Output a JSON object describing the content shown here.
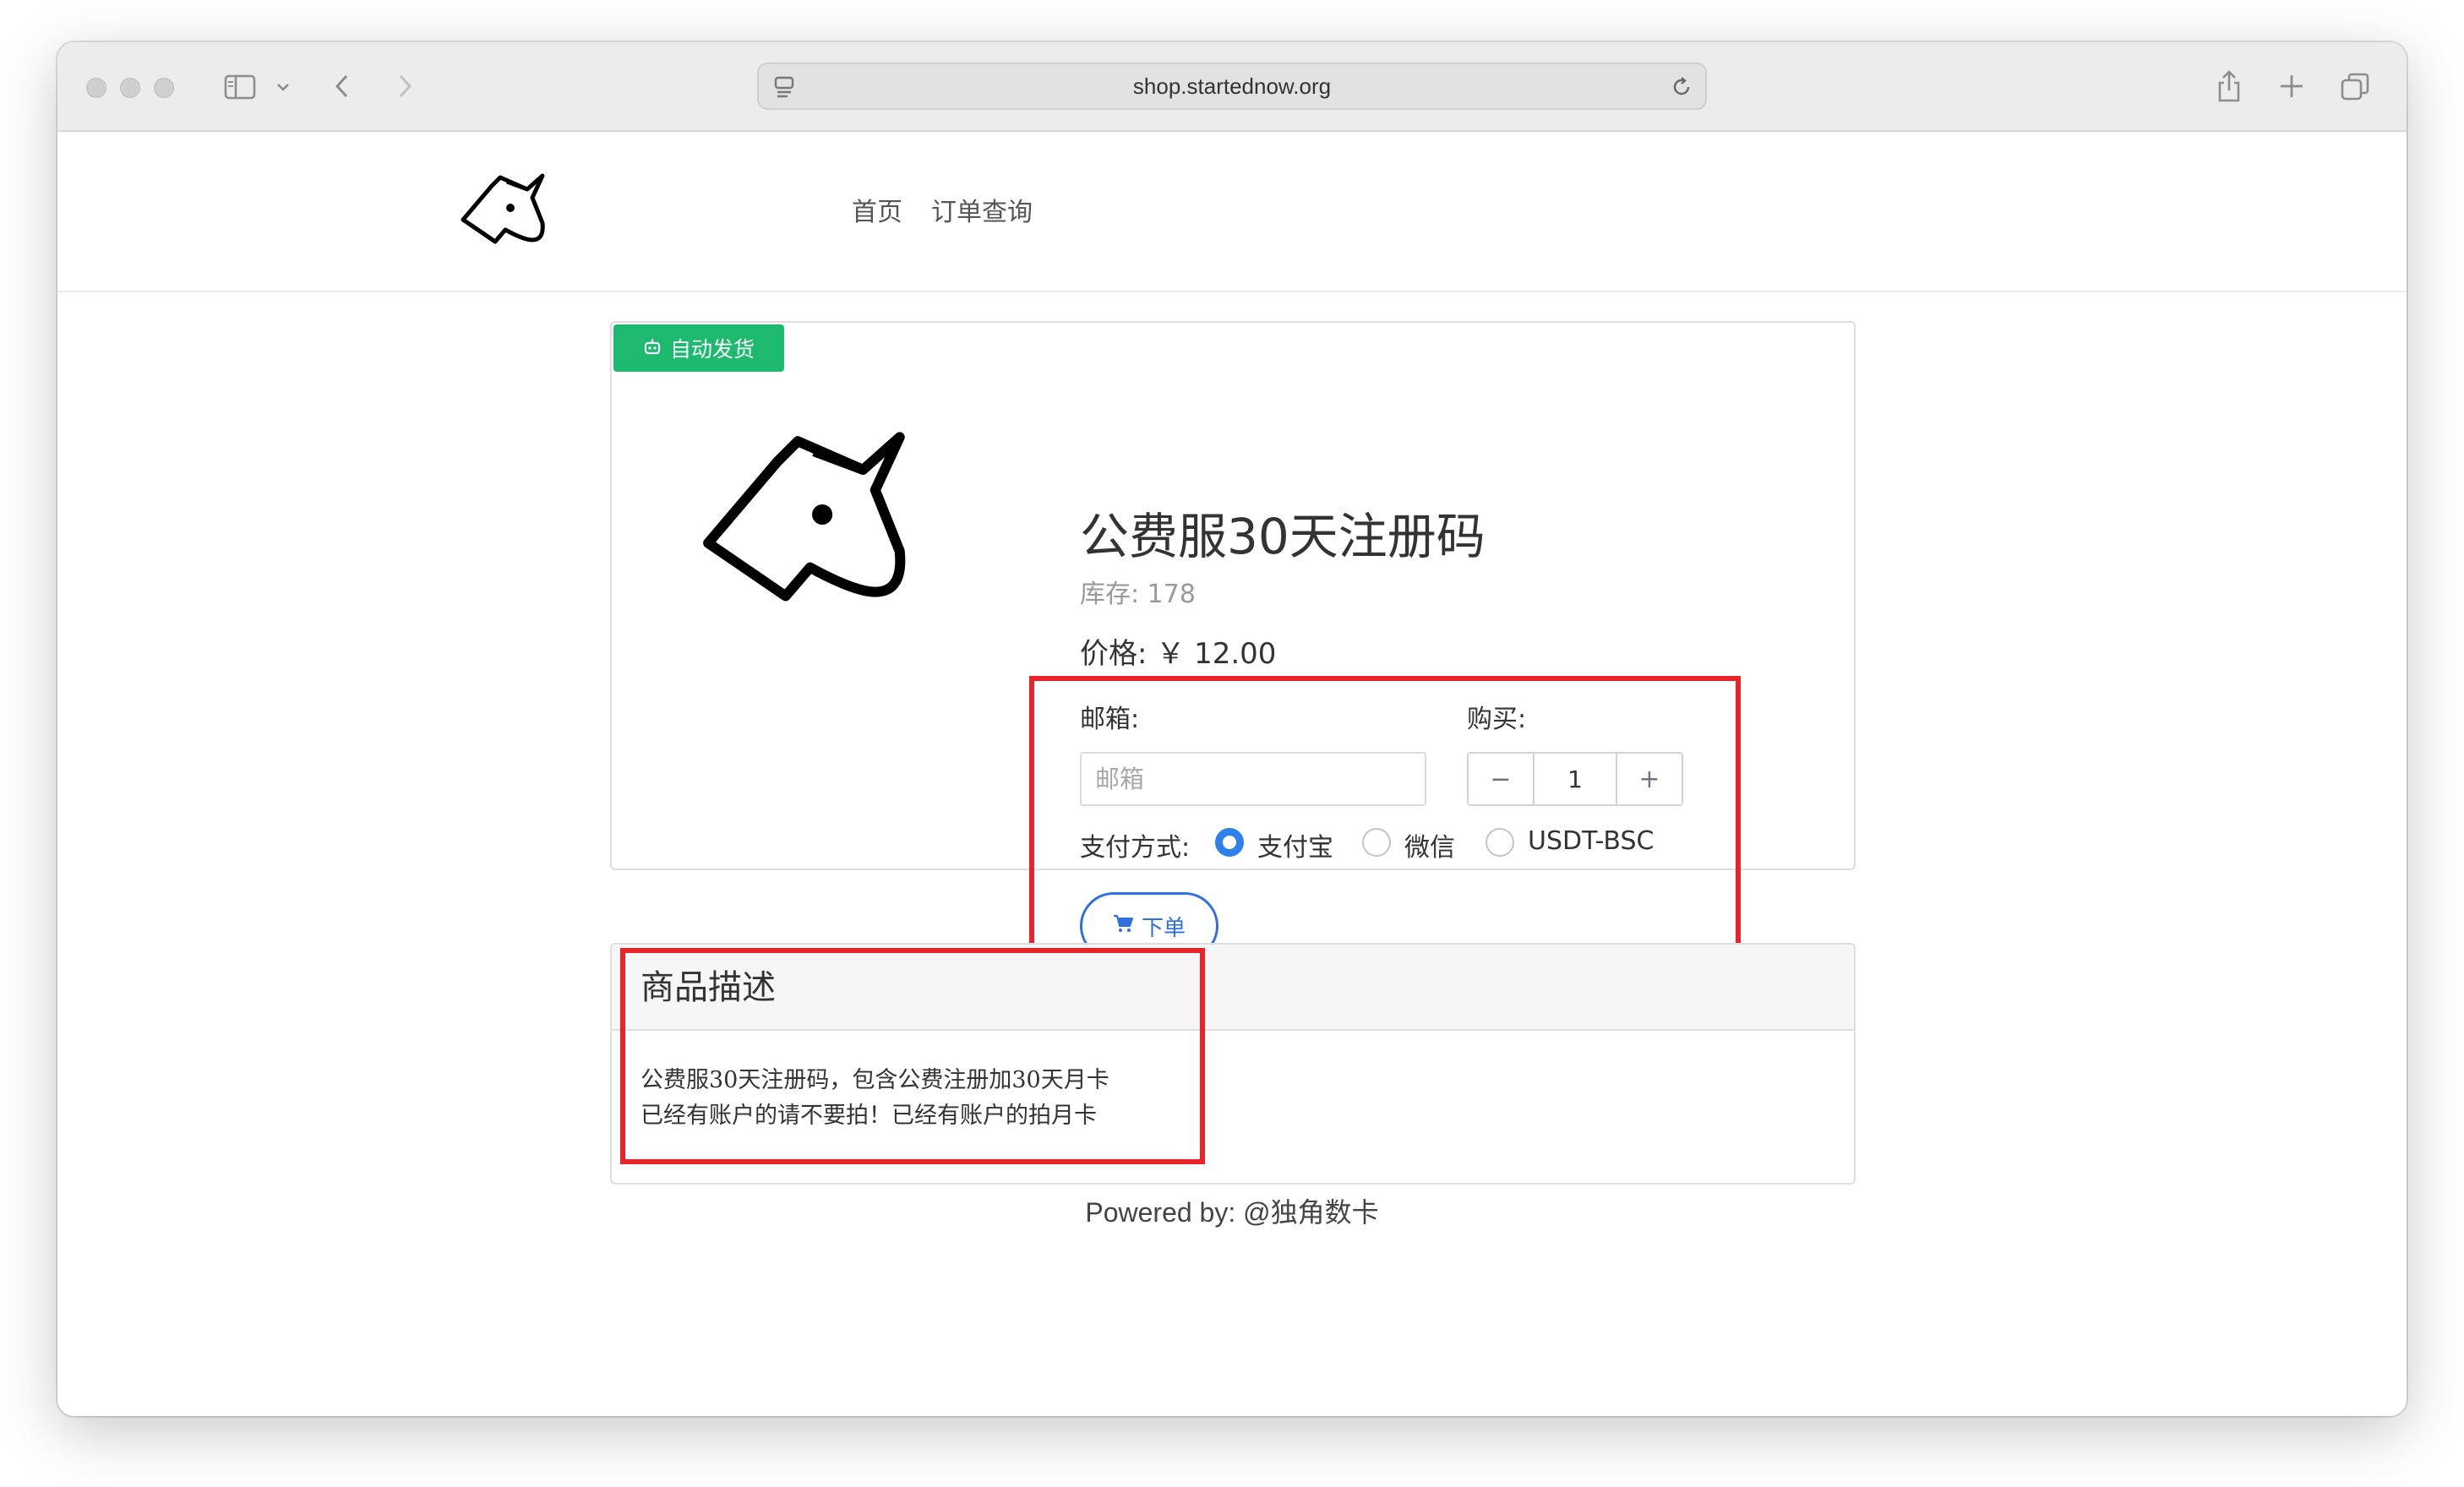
{
  "browser": {
    "url": "shop.startednow.org"
  },
  "nav": {
    "links": [
      "首页",
      "订单查询"
    ]
  },
  "product": {
    "badge": "自动发货",
    "title": "公费服30天注册码",
    "stock_label": "库存:",
    "stock_value": "178",
    "price_label": "价格:",
    "price_value": "￥ 12.00"
  },
  "form": {
    "email_label": "邮箱:",
    "email_placeholder": "邮箱",
    "email_value": "",
    "buy_label": "购买:",
    "minus": "−",
    "plus": "+",
    "quantity": "1",
    "payment_label": "支付方式:",
    "payment_options": [
      "支付宝",
      "微信",
      "USDT-BSC"
    ],
    "payment_selected": "支付宝",
    "submit_label": "下单"
  },
  "description": {
    "title": "商品描述",
    "lines": [
      "公费服30天注册码，包含公费注册加30天月卡",
      "已经有账户的请不要拍！已经有账户的拍月卡"
    ]
  },
  "footer": {
    "text": "Powered by: @独角数卡"
  },
  "colors": {
    "badge_green": "#1cb96f",
    "accent_blue": "#2f80ed",
    "highlight_red": "#e8232a"
  }
}
